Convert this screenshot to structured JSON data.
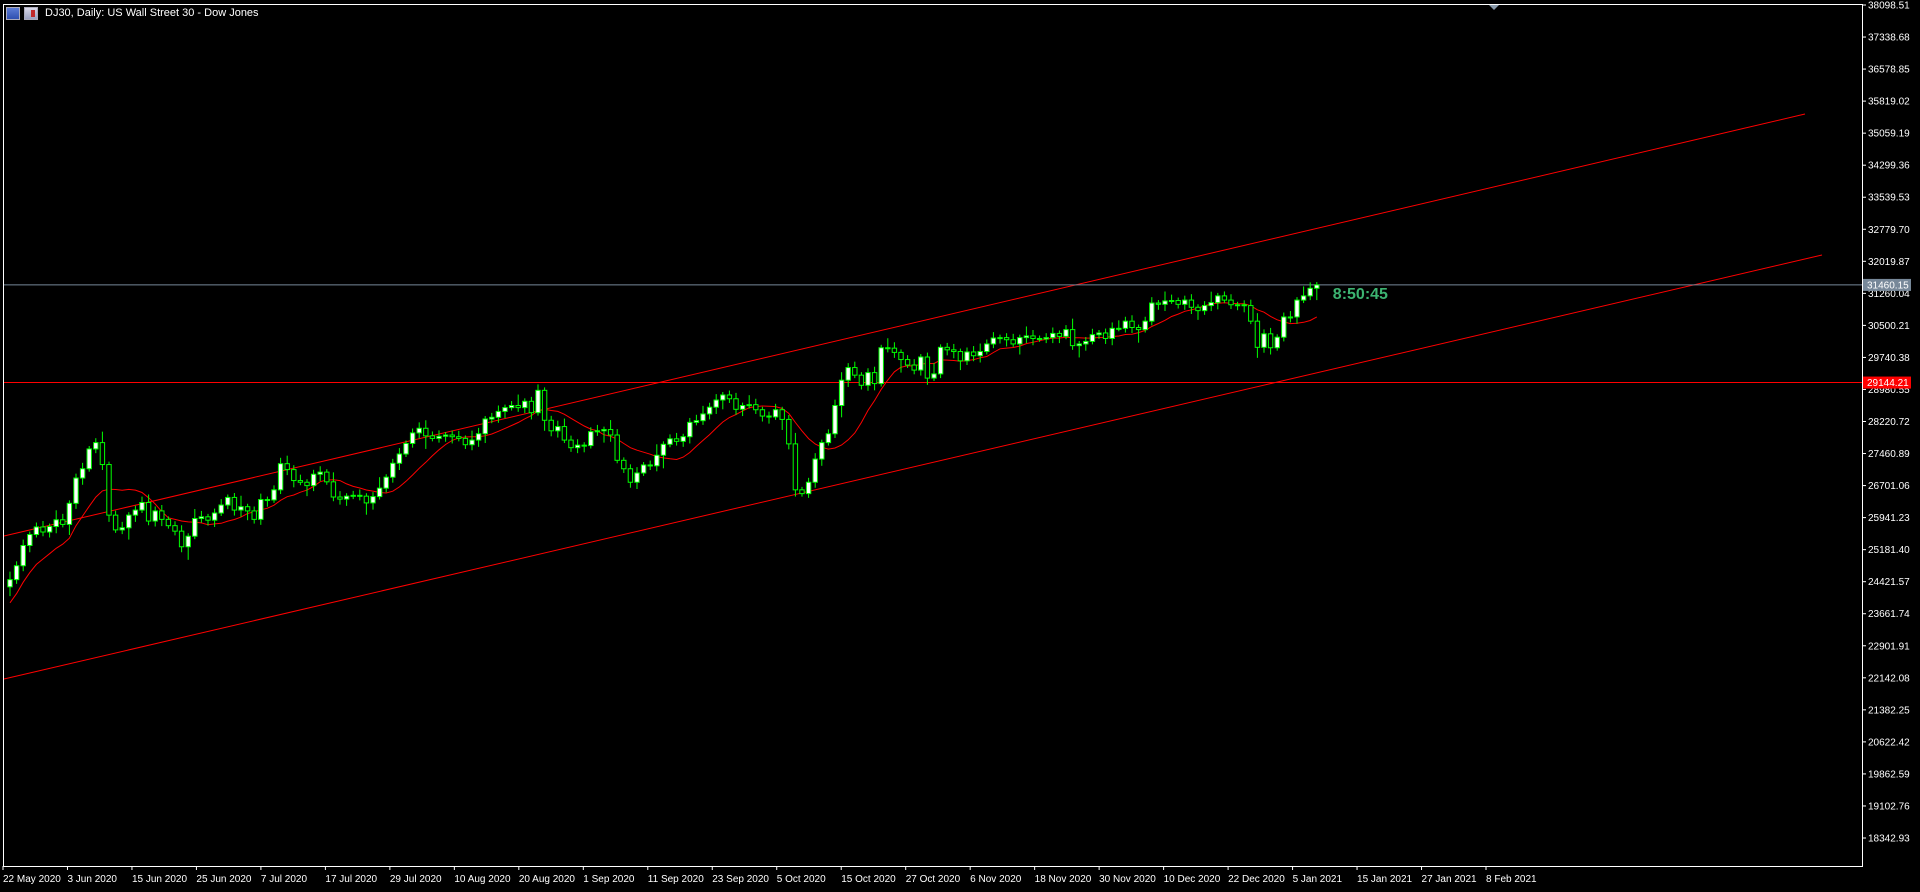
{
  "window": {
    "title": "DJ30, Daily:  US Wall Street 30 - Dow Jones",
    "icons": [
      "chart-window-icon",
      "symbol-flag-icon"
    ]
  },
  "colors": {
    "background": "#000000",
    "frame": "#ffffff",
    "bull_candle": "#ffffff",
    "bear_candle": "#000000",
    "wick": "#00ff00",
    "moving_average": "#ff0000",
    "channel": "#ff0000",
    "bid_line": "#778899",
    "resistance": "#ff0000",
    "timer": "#3cb371",
    "axis_text": "#ffffff"
  },
  "timer_text": "8:50:45",
  "chart_data": {
    "type": "candlestick",
    "title": "DJ30, Daily:  US Wall Street 30 - Dow Jones",
    "y_ticks": [
      "38098.51",
      "37338.68",
      "36578.85",
      "35819.02",
      "35059.19",
      "34299.36",
      "33539.53",
      "32779.70",
      "32019.87",
      "31260.04",
      "30500.21",
      "29740.38",
      "28980.55",
      "28220.72",
      "27460.89",
      "26701.06",
      "25941.23",
      "25181.40",
      "24421.57",
      "23661.74",
      "22901.91",
      "22142.08",
      "21382.25",
      "20622.42",
      "19862.59",
      "19102.76",
      "18342.93"
    ],
    "ylim": [
      17583.1,
      38098.51
    ],
    "x_ticks": [
      "22 May 2020",
      "3 Jun 2020",
      "15 Jun 2020",
      "25 Jun 2020",
      "7 Jul 2020",
      "17 Jul 2020",
      "29 Jul 2020",
      "10 Aug 2020",
      "20 Aug 2020",
      "1 Sep 2020",
      "11 Sep 2020",
      "23 Sep 2020",
      "5 Oct 2020",
      "15 Oct 2020",
      "27 Oct 2020",
      "6 Nov 2020",
      "18 Nov 2020",
      "30 Nov 2020",
      "10 Dec 2020",
      "22 Dec 2020",
      "5 Jan 2021",
      "15 Jan 2021",
      "27 Jan 2021",
      "8 Feb 2021"
    ],
    "price_labels": [
      {
        "name": "bid",
        "value": "31460.15"
      },
      {
        "name": "resistance",
        "value": "29144.21"
      }
    ],
    "closes": [
      24470,
      24800,
      25280,
      25540,
      25720,
      25600,
      25730,
      25890,
      25780,
      26280,
      26880,
      27100,
      27570,
      27720,
      27200,
      26000,
      25650,
      25700,
      26000,
      26120,
      26300,
      25860,
      26100,
      25900,
      25750,
      25620,
      25250,
      25500,
      25920,
      25960,
      25880,
      26050,
      26240,
      26420,
      26120,
      26200,
      26100,
      25900,
      26370,
      26360,
      26600,
      27220,
      27080,
      26820,
      26780,
      26700,
      26970,
      27020,
      26790,
      26430,
      26380,
      26450,
      26470,
      26450,
      26290,
      26440,
      26640,
      26900,
      27230,
      27450,
      27700,
      27950,
      28060,
      27880,
      27820,
      27870,
      27900,
      27860,
      27820,
      27670,
      27780,
      27930,
      28280,
      28320,
      28460,
      28550,
      28600,
      28550,
      28700,
      28430,
      28960,
      28250,
      28000,
      28100,
      27780,
      27600,
      27660,
      27650,
      27980,
      28000,
      28030,
      27900,
      27300,
      27100,
      26780,
      27000,
      27190,
      27170,
      27420,
      27680,
      27810,
      27750,
      27860,
      28200,
      28240,
      28400,
      28560,
      28730,
      28850,
      28760,
      28510,
      28600,
      28620,
      28500,
      28350,
      28330,
      28500,
      28270,
      27690,
      26600,
      26510,
      26780,
      27330,
      27720,
      27930,
      28600,
      29200,
      29500,
      29320,
      29080,
      29380,
      29120,
      29970,
      29960,
      29860,
      29690,
      29560,
      29440,
      29750,
      29250,
      29350,
      29980,
      29920,
      29880,
      29660,
      29870,
      29780,
      29880,
      30060,
      30200,
      30210,
      30160,
      30060,
      30210,
      30250,
      30190,
      30180,
      30210,
      30310,
      30240,
      30400,
      30020,
      30060,
      30120,
      30280,
      30320,
      30190,
      30430,
      30430,
      30600,
      30450,
      30400,
      30600,
      31030,
      31000,
      31080,
      31090,
      31000,
      31100,
      30930,
      30850,
      30970,
      31040,
      31200,
      31100,
      30990,
      30990,
      30970,
      30600,
      29980,
      30300,
      29970,
      30220,
      30700,
      30700,
      31100,
      31200,
      31380,
      31460
    ]
  }
}
